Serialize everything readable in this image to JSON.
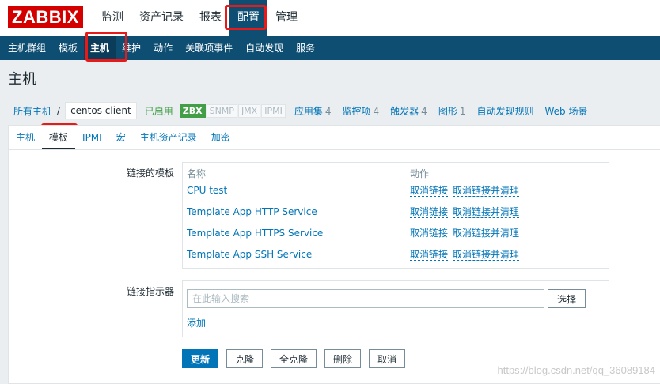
{
  "logo": "ZABBIX",
  "top_nav": [
    {
      "label": "监测"
    },
    {
      "label": "资产记录"
    },
    {
      "label": "报表"
    },
    {
      "label": "配置"
    },
    {
      "label": "管理"
    }
  ],
  "sub_nav": [
    {
      "label": "主机群组"
    },
    {
      "label": "模板"
    },
    {
      "label": "主机"
    },
    {
      "label": "维护"
    },
    {
      "label": "动作"
    },
    {
      "label": "关联项事件"
    },
    {
      "label": "自动发现"
    },
    {
      "label": "服务"
    }
  ],
  "page_title": "主机",
  "breadcrumb": {
    "all_hosts": "所有主机",
    "separator": "/",
    "current": "centos client",
    "status": "已启用",
    "badges": [
      "ZBX",
      "SNMP",
      "JMX",
      "IPMI"
    ],
    "links": [
      {
        "label": "应用集",
        "count": "4"
      },
      {
        "label": "监控项",
        "count": "4"
      },
      {
        "label": "触发器",
        "count": "4"
      },
      {
        "label": "图形",
        "count": "1"
      },
      {
        "label": "自动发现规则",
        "count": ""
      },
      {
        "label": "Web 场景",
        "count": ""
      }
    ]
  },
  "tabs": [
    {
      "label": "主机"
    },
    {
      "label": "模板"
    },
    {
      "label": "IPMI"
    },
    {
      "label": "宏"
    },
    {
      "label": "主机资产记录"
    },
    {
      "label": "加密"
    }
  ],
  "linked_templates": {
    "label": "链接的模板",
    "col_name": "名称",
    "col_action": "动作",
    "unlink": "取消链接",
    "unlink_clear": "取消链接并清理",
    "rows": [
      {
        "name": "CPU test"
      },
      {
        "name": "Template App HTTP Service"
      },
      {
        "name": "Template App HTTPS Service"
      },
      {
        "name": "Template App SSH Service"
      }
    ]
  },
  "link_new": {
    "label": "链接指示器",
    "placeholder": "在此输入搜索",
    "select_label": "选择",
    "add_label": "添加"
  },
  "buttons": {
    "update": "更新",
    "clone": "克隆",
    "full_clone": "全克隆",
    "delete": "删除",
    "cancel": "取消"
  },
  "watermark": "https://blog.csdn.net/qq_36089184",
  "colors": {
    "header_bg": "#0f4e73",
    "link": "#0275b8",
    "enabled": "#429e47",
    "logo": "#d40000",
    "highlight": "#e81919"
  }
}
